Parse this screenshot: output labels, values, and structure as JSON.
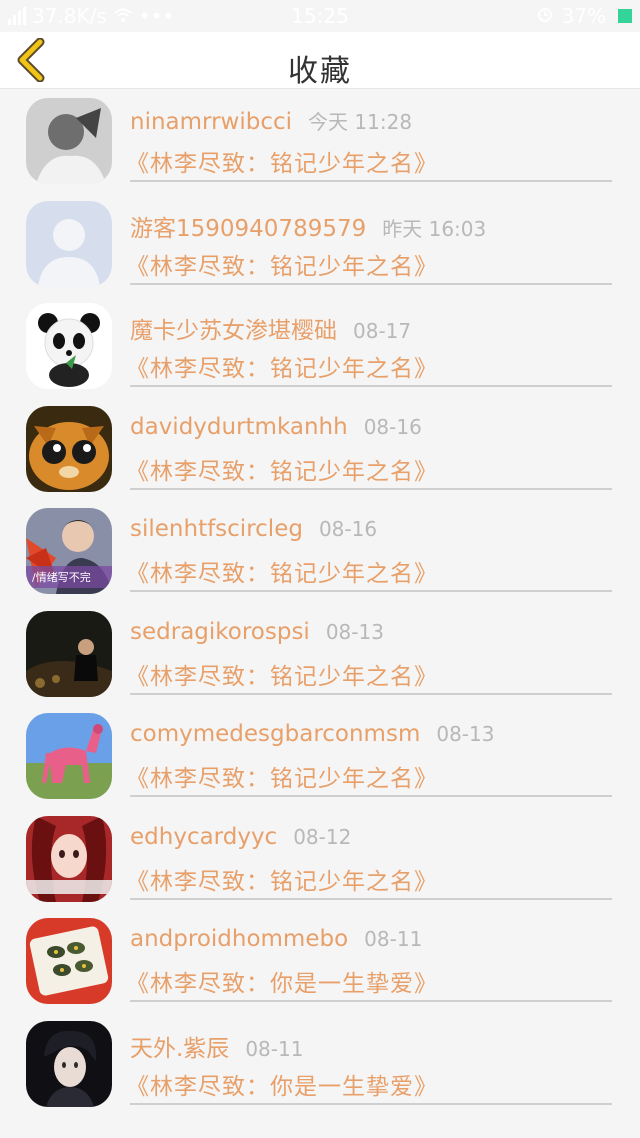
{
  "status_bar": {
    "network_speed": "37.8K/s",
    "time": "15:25",
    "battery": "37%"
  },
  "nav": {
    "back_icon": "chevron-left-icon",
    "title": "收藏"
  },
  "colors": {
    "accent": "#e8a06a",
    "back_arrow": "#f0c419",
    "time_text": "#b8b8b8"
  },
  "items": [
    {
      "name": "ninamrrwibcci",
      "time": "今天 11:28",
      "book": "《林李尽致：铭记少年之名》"
    },
    {
      "name": "游客1590940789579",
      "time": "昨天 16:03",
      "book": "《林李尽致：铭记少年之名》"
    },
    {
      "name": "魔卡少苏女渗堪樱础",
      "time": "08-17",
      "book": "《林李尽致：铭记少年之名》"
    },
    {
      "name": "davidydurtmkanhh",
      "time": "08-16",
      "book": "《林李尽致：铭记少年之名》"
    },
    {
      "name": "silenhtfscircleg",
      "time": "08-16",
      "book": "《林李尽致：铭记少年之名》",
      "avatar_caption": "/情绪写不完"
    },
    {
      "name": "sedragikorospsi",
      "time": "08-13",
      "book": "《林李尽致：铭记少年之名》"
    },
    {
      "name": "comymedesgbarconmsm",
      "time": "08-13",
      "book": "《林李尽致：铭记少年之名》"
    },
    {
      "name": "edhycardyyc",
      "time": "08-12",
      "book": "《林李尽致：铭记少年之名》"
    },
    {
      "name": "andproidhommebo",
      "time": "08-11",
      "book": "《林李尽致：你是一生挚爱》"
    },
    {
      "name": "天外.紫辰",
      "time": "08-11",
      "book": "《林李尽致：你是一生挚爱》"
    }
  ]
}
